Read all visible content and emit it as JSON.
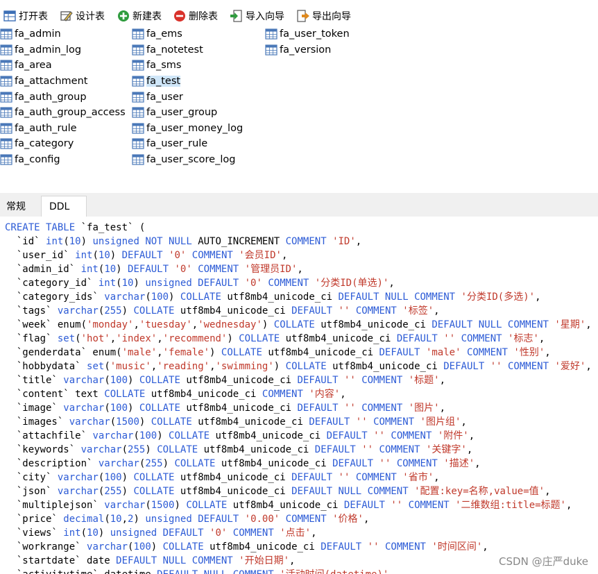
{
  "toolbar": {
    "buttons": [
      {
        "label": "打开表",
        "icon": "table-open-icon"
      },
      {
        "label": "设计表",
        "icon": "pencil-ruler-icon"
      },
      {
        "label": "新建表",
        "icon": "plus-circle-icon"
      },
      {
        "label": "删除表",
        "icon": "minus-circle-icon"
      },
      {
        "label": "导入向导",
        "icon": "import-icon"
      },
      {
        "label": "导出向导",
        "icon": "export-icon"
      }
    ]
  },
  "tables": {
    "columns": [
      [
        "fa_admin",
        "fa_admin_log",
        "fa_area",
        "fa_attachment",
        "fa_auth_group",
        "fa_auth_group_access",
        "fa_auth_rule",
        "fa_category",
        "fa_config"
      ],
      [
        "fa_ems",
        "fa_notetest",
        "fa_sms",
        "fa_test",
        "fa_user",
        "fa_user_group",
        "fa_user_money_log",
        "fa_user_rule",
        "fa_user_score_log"
      ],
      [
        "fa_user_token",
        "fa_version"
      ]
    ],
    "selected": "fa_test"
  },
  "tabs": [
    {
      "label": "常规",
      "active": false
    },
    {
      "label": "DDL",
      "active": true
    }
  ],
  "colors": {
    "keyword": "#2c5bd6",
    "string": "#c0392b"
  },
  "ddl": [
    [
      [
        "k",
        "CREATE TABLE"
      ],
      [
        "p",
        " `fa_test` ("
      ]
    ],
    [
      [
        "p",
        "  `id` "
      ],
      [
        "k",
        "int"
      ],
      [
        "p",
        "("
      ],
      [
        "k",
        "10"
      ],
      [
        "p",
        ") "
      ],
      [
        "k",
        "unsigned NOT NULL"
      ],
      [
        "p",
        " AUTO_INCREMENT "
      ],
      [
        "k",
        "COMMENT"
      ],
      [
        "p",
        " "
      ],
      [
        "s",
        "'ID'"
      ],
      [
        "p",
        ","
      ]
    ],
    [
      [
        "p",
        "  `user_id` "
      ],
      [
        "k",
        "int"
      ],
      [
        "p",
        "("
      ],
      [
        "k",
        "10"
      ],
      [
        "p",
        ") "
      ],
      [
        "k",
        "DEFAULT"
      ],
      [
        "p",
        " "
      ],
      [
        "s",
        "'0'"
      ],
      [
        "p",
        " "
      ],
      [
        "k",
        "COMMENT"
      ],
      [
        "p",
        " "
      ],
      [
        "s",
        "'会员ID'"
      ],
      [
        "p",
        ","
      ]
    ],
    [
      [
        "p",
        "  `admin_id` "
      ],
      [
        "k",
        "int"
      ],
      [
        "p",
        "("
      ],
      [
        "k",
        "10"
      ],
      [
        "p",
        ") "
      ],
      [
        "k",
        "DEFAULT"
      ],
      [
        "p",
        " "
      ],
      [
        "s",
        "'0'"
      ],
      [
        "p",
        " "
      ],
      [
        "k",
        "COMMENT"
      ],
      [
        "p",
        " "
      ],
      [
        "s",
        "'管理员ID'"
      ],
      [
        "p",
        ","
      ]
    ],
    [
      [
        "p",
        "  `category_id` "
      ],
      [
        "k",
        "int"
      ],
      [
        "p",
        "("
      ],
      [
        "k",
        "10"
      ],
      [
        "p",
        ") "
      ],
      [
        "k",
        "unsigned DEFAULT"
      ],
      [
        "p",
        " "
      ],
      [
        "s",
        "'0'"
      ],
      [
        "p",
        " "
      ],
      [
        "k",
        "COMMENT"
      ],
      [
        "p",
        " "
      ],
      [
        "s",
        "'分类ID(单选)'"
      ],
      [
        "p",
        ","
      ]
    ],
    [
      [
        "p",
        "  `category_ids` "
      ],
      [
        "k",
        "varchar"
      ],
      [
        "p",
        "("
      ],
      [
        "k",
        "100"
      ],
      [
        "p",
        ") "
      ],
      [
        "k",
        "COLLATE"
      ],
      [
        "p",
        " utf8mb4_unicode_ci "
      ],
      [
        "k",
        "DEFAULT NULL COMMENT"
      ],
      [
        "p",
        " "
      ],
      [
        "s",
        "'分类ID(多选)'"
      ],
      [
        "p",
        ","
      ]
    ],
    [
      [
        "p",
        "  `tags` "
      ],
      [
        "k",
        "varchar"
      ],
      [
        "p",
        "("
      ],
      [
        "k",
        "255"
      ],
      [
        "p",
        ") "
      ],
      [
        "k",
        "COLLATE"
      ],
      [
        "p",
        " utf8mb4_unicode_ci "
      ],
      [
        "k",
        "DEFAULT"
      ],
      [
        "p",
        " "
      ],
      [
        "s",
        "''"
      ],
      [
        "p",
        " "
      ],
      [
        "k",
        "COMMENT"
      ],
      [
        "p",
        " "
      ],
      [
        "s",
        "'标签'"
      ],
      [
        "p",
        ","
      ]
    ],
    [
      [
        "p",
        "  `week` enum("
      ],
      [
        "s",
        "'monday'"
      ],
      [
        "p",
        ","
      ],
      [
        "s",
        "'tuesday'"
      ],
      [
        "p",
        ","
      ],
      [
        "s",
        "'wednesday'"
      ],
      [
        "p",
        ") "
      ],
      [
        "k",
        "COLLATE"
      ],
      [
        "p",
        " utf8mb4_unicode_ci "
      ],
      [
        "k",
        "DEFAULT NULL COMMENT"
      ],
      [
        "p",
        " "
      ],
      [
        "s",
        "'星期'"
      ],
      [
        "p",
        ","
      ]
    ],
    [
      [
        "p",
        "  `flag` "
      ],
      [
        "k",
        "set"
      ],
      [
        "p",
        "("
      ],
      [
        "s",
        "'hot'"
      ],
      [
        "p",
        ","
      ],
      [
        "s",
        "'index'"
      ],
      [
        "p",
        ","
      ],
      [
        "s",
        "'recommend'"
      ],
      [
        "p",
        ") "
      ],
      [
        "k",
        "COLLATE"
      ],
      [
        "p",
        " utf8mb4_unicode_ci "
      ],
      [
        "k",
        "DEFAULT"
      ],
      [
        "p",
        " "
      ],
      [
        "s",
        "''"
      ],
      [
        "p",
        " "
      ],
      [
        "k",
        "COMMENT"
      ],
      [
        "p",
        " "
      ],
      [
        "s",
        "'标志'"
      ],
      [
        "p",
        ","
      ]
    ],
    [
      [
        "p",
        "  `genderdata` enum("
      ],
      [
        "s",
        "'male'"
      ],
      [
        "p",
        ","
      ],
      [
        "s",
        "'female'"
      ],
      [
        "p",
        ") "
      ],
      [
        "k",
        "COLLATE"
      ],
      [
        "p",
        " utf8mb4_unicode_ci "
      ],
      [
        "k",
        "DEFAULT"
      ],
      [
        "p",
        " "
      ],
      [
        "s",
        "'male'"
      ],
      [
        "p",
        " "
      ],
      [
        "k",
        "COMMENT"
      ],
      [
        "p",
        " "
      ],
      [
        "s",
        "'性别'"
      ],
      [
        "p",
        ","
      ]
    ],
    [
      [
        "p",
        "  `hobbydata` "
      ],
      [
        "k",
        "set"
      ],
      [
        "p",
        "("
      ],
      [
        "s",
        "'music'"
      ],
      [
        "p",
        ","
      ],
      [
        "s",
        "'reading'"
      ],
      [
        "p",
        ","
      ],
      [
        "s",
        "'swimming'"
      ],
      [
        "p",
        ") "
      ],
      [
        "k",
        "COLLATE"
      ],
      [
        "p",
        " utf8mb4_unicode_ci "
      ],
      [
        "k",
        "DEFAULT"
      ],
      [
        "p",
        " "
      ],
      [
        "s",
        "''"
      ],
      [
        "p",
        " "
      ],
      [
        "k",
        "COMMENT"
      ],
      [
        "p",
        " "
      ],
      [
        "s",
        "'爱好'"
      ],
      [
        "p",
        ","
      ]
    ],
    [
      [
        "p",
        "  `title` "
      ],
      [
        "k",
        "varchar"
      ],
      [
        "p",
        "("
      ],
      [
        "k",
        "100"
      ],
      [
        "p",
        ") "
      ],
      [
        "k",
        "COLLATE"
      ],
      [
        "p",
        " utf8mb4_unicode_ci "
      ],
      [
        "k",
        "DEFAULT"
      ],
      [
        "p",
        " "
      ],
      [
        "s",
        "''"
      ],
      [
        "p",
        " "
      ],
      [
        "k",
        "COMMENT"
      ],
      [
        "p",
        " "
      ],
      [
        "s",
        "'标题'"
      ],
      [
        "p",
        ","
      ]
    ],
    [
      [
        "p",
        "  `content` text "
      ],
      [
        "k",
        "COLLATE"
      ],
      [
        "p",
        " utf8mb4_unicode_ci "
      ],
      [
        "k",
        "COMMENT"
      ],
      [
        "p",
        " "
      ],
      [
        "s",
        "'内容'"
      ],
      [
        "p",
        ","
      ]
    ],
    [
      [
        "p",
        "  `image` "
      ],
      [
        "k",
        "varchar"
      ],
      [
        "p",
        "("
      ],
      [
        "k",
        "100"
      ],
      [
        "p",
        ") "
      ],
      [
        "k",
        "COLLATE"
      ],
      [
        "p",
        " utf8mb4_unicode_ci "
      ],
      [
        "k",
        "DEFAULT"
      ],
      [
        "p",
        " "
      ],
      [
        "s",
        "''"
      ],
      [
        "p",
        " "
      ],
      [
        "k",
        "COMMENT"
      ],
      [
        "p",
        " "
      ],
      [
        "s",
        "'图片'"
      ],
      [
        "p",
        ","
      ]
    ],
    [
      [
        "p",
        "  `images` "
      ],
      [
        "k",
        "varchar"
      ],
      [
        "p",
        "("
      ],
      [
        "k",
        "1500"
      ],
      [
        "p",
        ") "
      ],
      [
        "k",
        "COLLATE"
      ],
      [
        "p",
        " utf8mb4_unicode_ci "
      ],
      [
        "k",
        "DEFAULT"
      ],
      [
        "p",
        " "
      ],
      [
        "s",
        "''"
      ],
      [
        "p",
        " "
      ],
      [
        "k",
        "COMMENT"
      ],
      [
        "p",
        " "
      ],
      [
        "s",
        "'图片组'"
      ],
      [
        "p",
        ","
      ]
    ],
    [
      [
        "p",
        "  `attachfile` "
      ],
      [
        "k",
        "varchar"
      ],
      [
        "p",
        "("
      ],
      [
        "k",
        "100"
      ],
      [
        "p",
        ") "
      ],
      [
        "k",
        "COLLATE"
      ],
      [
        "p",
        " utf8mb4_unicode_ci "
      ],
      [
        "k",
        "DEFAULT"
      ],
      [
        "p",
        " "
      ],
      [
        "s",
        "''"
      ],
      [
        "p",
        " "
      ],
      [
        "k",
        "COMMENT"
      ],
      [
        "p",
        " "
      ],
      [
        "s",
        "'附件'"
      ],
      [
        "p",
        ","
      ]
    ],
    [
      [
        "p",
        "  `keywords` "
      ],
      [
        "k",
        "varchar"
      ],
      [
        "p",
        "("
      ],
      [
        "k",
        "255"
      ],
      [
        "p",
        ") "
      ],
      [
        "k",
        "COLLATE"
      ],
      [
        "p",
        " utf8mb4_unicode_ci "
      ],
      [
        "k",
        "DEFAULT"
      ],
      [
        "p",
        " "
      ],
      [
        "s",
        "''"
      ],
      [
        "p",
        " "
      ],
      [
        "k",
        "COMMENT"
      ],
      [
        "p",
        " "
      ],
      [
        "s",
        "'关键字'"
      ],
      [
        "p",
        ","
      ]
    ],
    [
      [
        "p",
        "  `description` "
      ],
      [
        "k",
        "varchar"
      ],
      [
        "p",
        "("
      ],
      [
        "k",
        "255"
      ],
      [
        "p",
        ") "
      ],
      [
        "k",
        "COLLATE"
      ],
      [
        "p",
        " utf8mb4_unicode_ci "
      ],
      [
        "k",
        "DEFAULT"
      ],
      [
        "p",
        " "
      ],
      [
        "s",
        "''"
      ],
      [
        "p",
        " "
      ],
      [
        "k",
        "COMMENT"
      ],
      [
        "p",
        " "
      ],
      [
        "s",
        "'描述'"
      ],
      [
        "p",
        ","
      ]
    ],
    [
      [
        "p",
        "  `city` "
      ],
      [
        "k",
        "varchar"
      ],
      [
        "p",
        "("
      ],
      [
        "k",
        "100"
      ],
      [
        "p",
        ") "
      ],
      [
        "k",
        "COLLATE"
      ],
      [
        "p",
        " utf8mb4_unicode_ci "
      ],
      [
        "k",
        "DEFAULT"
      ],
      [
        "p",
        " "
      ],
      [
        "s",
        "''"
      ],
      [
        "p",
        " "
      ],
      [
        "k",
        "COMMENT"
      ],
      [
        "p",
        " "
      ],
      [
        "s",
        "'省市'"
      ],
      [
        "p",
        ","
      ]
    ],
    [
      [
        "p",
        "  `json` "
      ],
      [
        "k",
        "varchar"
      ],
      [
        "p",
        "("
      ],
      [
        "k",
        "255"
      ],
      [
        "p",
        ") "
      ],
      [
        "k",
        "COLLATE"
      ],
      [
        "p",
        " utf8mb4_unicode_ci "
      ],
      [
        "k",
        "DEFAULT NULL COMMENT"
      ],
      [
        "p",
        " "
      ],
      [
        "s",
        "'配置:key=名称,value=值'"
      ],
      [
        "p",
        ","
      ]
    ],
    [
      [
        "p",
        "  `multiplejson` "
      ],
      [
        "k",
        "varchar"
      ],
      [
        "p",
        "("
      ],
      [
        "k",
        "1500"
      ],
      [
        "p",
        ") "
      ],
      [
        "k",
        "COLLATE"
      ],
      [
        "p",
        " utf8mb4_unicode_ci "
      ],
      [
        "k",
        "DEFAULT"
      ],
      [
        "p",
        " "
      ],
      [
        "s",
        "''"
      ],
      [
        "p",
        " "
      ],
      [
        "k",
        "COMMENT"
      ],
      [
        "p",
        " "
      ],
      [
        "s",
        "'二维数组:title=标题'"
      ],
      [
        "p",
        ","
      ]
    ],
    [
      [
        "p",
        "  `price` "
      ],
      [
        "k",
        "decimal"
      ],
      [
        "p",
        "("
      ],
      [
        "k",
        "10"
      ],
      [
        "p",
        ","
      ],
      [
        "k",
        "2"
      ],
      [
        "p",
        ") "
      ],
      [
        "k",
        "unsigned DEFAULT"
      ],
      [
        "p",
        " "
      ],
      [
        "s",
        "'0.00'"
      ],
      [
        "p",
        " "
      ],
      [
        "k",
        "COMMENT"
      ],
      [
        "p",
        " "
      ],
      [
        "s",
        "'价格'"
      ],
      [
        "p",
        ","
      ]
    ],
    [
      [
        "p",
        "  `views` "
      ],
      [
        "k",
        "int"
      ],
      [
        "p",
        "("
      ],
      [
        "k",
        "10"
      ],
      [
        "p",
        ") "
      ],
      [
        "k",
        "unsigned DEFAULT"
      ],
      [
        "p",
        " "
      ],
      [
        "s",
        "'0'"
      ],
      [
        "p",
        " "
      ],
      [
        "k",
        "COMMENT"
      ],
      [
        "p",
        " "
      ],
      [
        "s",
        "'点击'"
      ],
      [
        "p",
        ","
      ]
    ],
    [
      [
        "p",
        "  `workrange` "
      ],
      [
        "k",
        "varchar"
      ],
      [
        "p",
        "("
      ],
      [
        "k",
        "100"
      ],
      [
        "p",
        ") "
      ],
      [
        "k",
        "COLLATE"
      ],
      [
        "p",
        " utf8mb4_unicode_ci "
      ],
      [
        "k",
        "DEFAULT"
      ],
      [
        "p",
        " "
      ],
      [
        "s",
        "''"
      ],
      [
        "p",
        " "
      ],
      [
        "k",
        "COMMENT"
      ],
      [
        "p",
        " "
      ],
      [
        "s",
        "'时间区间'"
      ],
      [
        "p",
        ","
      ]
    ],
    [
      [
        "p",
        "  `startdate` date "
      ],
      [
        "k",
        "DEFAULT NULL COMMENT"
      ],
      [
        "p",
        " "
      ],
      [
        "s",
        "'开始日期'"
      ],
      [
        "p",
        ","
      ]
    ],
    [
      [
        "p",
        "  `activitytime` datetime "
      ],
      [
        "k",
        "DEFAULT NULL COMMENT"
      ],
      [
        "p",
        " "
      ],
      [
        "s",
        "'活动时间(datetime)'"
      ],
      [
        "p",
        ","
      ]
    ]
  ],
  "watermark": "CSDN @庄严duke"
}
